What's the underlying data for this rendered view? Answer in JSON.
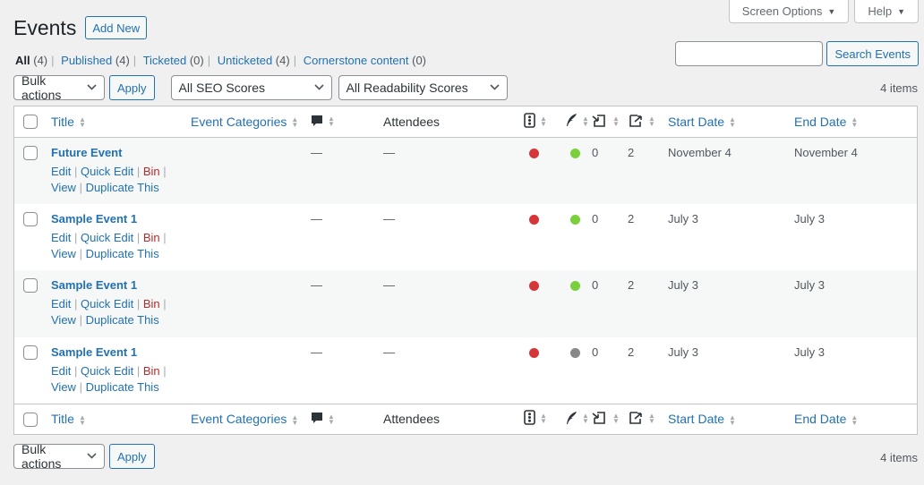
{
  "screen_meta": {
    "screen_options": "Screen Options",
    "help": "Help"
  },
  "heading": {
    "title": "Events",
    "add_new": "Add New"
  },
  "subsubsub": [
    {
      "label": "All",
      "count": "(4)",
      "current": true
    },
    {
      "label": "Published",
      "count": "(4)"
    },
    {
      "label": "Ticketed",
      "count": "(0)"
    },
    {
      "label": "Unticketed",
      "count": "(4)"
    },
    {
      "label": "Cornerstone content",
      "count": "(0)"
    }
  ],
  "search": {
    "value": "",
    "button": "Search Events"
  },
  "tablenav": {
    "bulk_actions": "Bulk actions",
    "apply": "Apply",
    "seo_filter": "All SEO Scores",
    "readability_filter": "All Readability Scores",
    "items": "4 items"
  },
  "columns": {
    "title": "Title",
    "categories": "Event Categories",
    "attendees": "Attendees",
    "start_date": "Start Date",
    "end_date": "End Date"
  },
  "colors": {
    "red": "#d63638",
    "green": "#7ad03a",
    "gray": "#888888",
    "link": "#2271b1",
    "bin": "#b32d2e"
  },
  "row_actions": {
    "edit": "Edit",
    "quick_edit": "Quick Edit",
    "bin": "Bin",
    "view": "View",
    "duplicate": "Duplicate This"
  },
  "rows": [
    {
      "title": "Future Event",
      "categories": "",
      "comments": "—",
      "attendees": "—",
      "seo": "red",
      "readability": "green",
      "links_in": "0",
      "links_out": "2",
      "start": "November 4",
      "end": "November 4"
    },
    {
      "title": "Sample Event 1",
      "categories": "",
      "comments": "—",
      "attendees": "—",
      "seo": "red",
      "readability": "green",
      "links_in": "0",
      "links_out": "2",
      "start": "July 3",
      "end": "July 3"
    },
    {
      "title": "Sample Event 1",
      "categories": "",
      "comments": "—",
      "attendees": "—",
      "seo": "red",
      "readability": "green",
      "links_in": "0",
      "links_out": "2",
      "start": "July 3",
      "end": "July 3"
    },
    {
      "title": "Sample Event 1",
      "categories": "",
      "comments": "—",
      "attendees": "—",
      "seo": "red",
      "readability": "gray",
      "links_in": "0",
      "links_out": "2",
      "start": "July 3",
      "end": "July 3"
    }
  ]
}
